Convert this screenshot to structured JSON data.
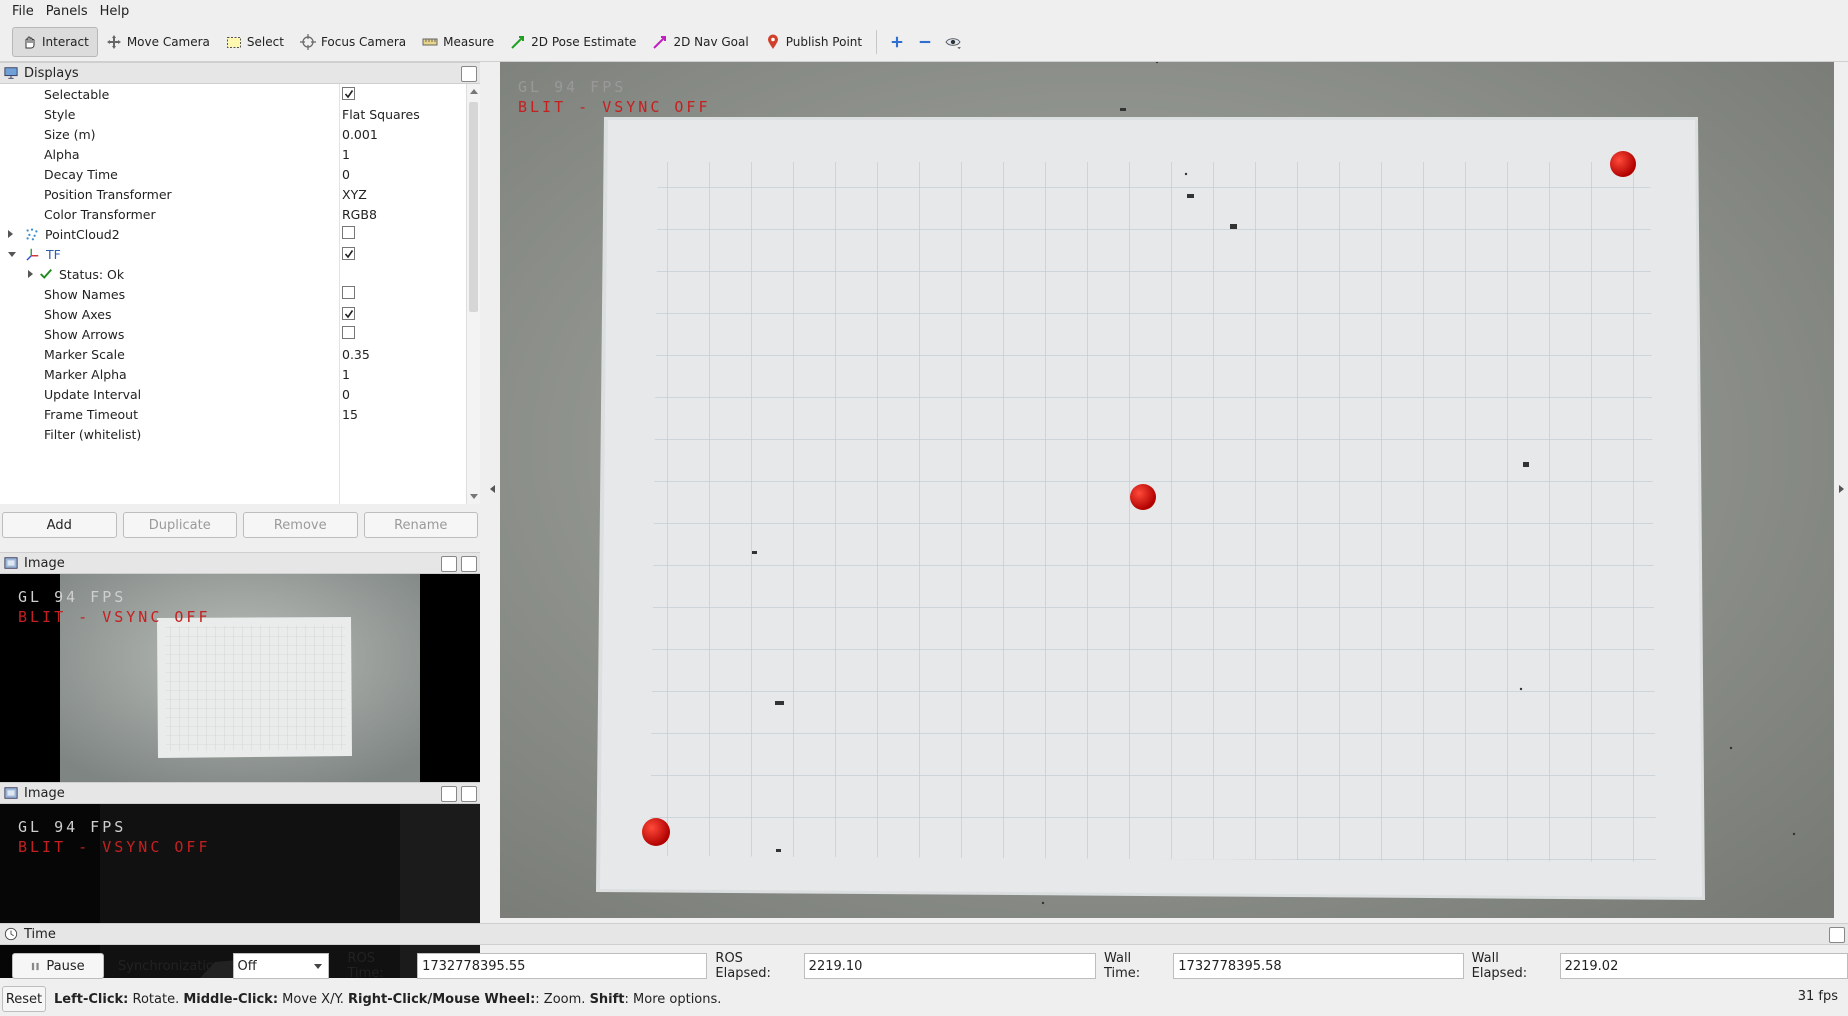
{
  "menu": [
    "File",
    "Panels",
    "Help"
  ],
  "toolbar": {
    "interact": "Interact",
    "move_camera": "Move Camera",
    "select": "Select",
    "focus_camera": "Focus Camera",
    "measure": "Measure",
    "pose_estimate": "2D Pose Estimate",
    "nav_goal": "2D Nav Goal",
    "publish_point": "Publish Point"
  },
  "displays": {
    "title": "Displays",
    "rows": [
      {
        "name": "Selectable",
        "value": "",
        "checkbox": true,
        "checked": true
      },
      {
        "name": "Style",
        "value": "Flat Squares"
      },
      {
        "name": "Size (m)",
        "value": "0.001"
      },
      {
        "name": "Alpha",
        "value": "1"
      },
      {
        "name": "Decay Time",
        "value": "0"
      },
      {
        "name": "Position Transformer",
        "value": "XYZ"
      },
      {
        "name": "Color Transformer",
        "value": "RGB8"
      },
      {
        "name": "PointCloud2",
        "value": "",
        "checkbox": true,
        "checked": false
      },
      {
        "name": "TF",
        "value": "",
        "checkbox": true,
        "checked": true
      },
      {
        "name": "Status: Ok",
        "value": ""
      },
      {
        "name": "Show Names",
        "value": "",
        "checkbox": true,
        "checked": false
      },
      {
        "name": "Show Axes",
        "value": "",
        "checkbox": true,
        "checked": true
      },
      {
        "name": "Show Arrows",
        "value": "",
        "checkbox": true,
        "checked": false
      },
      {
        "name": "Marker Scale",
        "value": "0.35"
      },
      {
        "name": "Marker Alpha",
        "value": "1"
      },
      {
        "name": "Update Interval",
        "value": "0"
      },
      {
        "name": "Frame Timeout",
        "value": "15"
      },
      {
        "name": "Filter (whitelist)",
        "value": ""
      }
    ],
    "buttons": {
      "add": "Add",
      "duplicate": "Duplicate",
      "remove": "Remove",
      "rename": "Rename"
    }
  },
  "image_panels": [
    {
      "title": "Image",
      "gl_fps": "GL 94 FPS",
      "blit": "BLIT - VSYNC OFF"
    },
    {
      "title": "Image",
      "gl_fps": "GL 94 FPS",
      "blit": "BLIT - VSYNC OFF"
    }
  ],
  "view3d": {
    "gl_fps": "GL 94 FPS",
    "blit": "BLIT - VSYNC OFF",
    "marker_color": "#e01010"
  },
  "time": {
    "title": "Time",
    "pause_label": "Pause",
    "sync_label": "Synchronization:",
    "sync_value": "Off",
    "ros_time_label": "ROS Time:",
    "ros_time": "1732778395.55",
    "ros_elapsed_label": "ROS Elapsed:",
    "ros_elapsed": "2219.10",
    "wall_time_label": "Wall Time:",
    "wall_time": "1732778395.58",
    "wall_elapsed_label": "Wall Elapsed:",
    "wall_elapsed": "2219.02"
  },
  "status": {
    "reset": "Reset",
    "left_click": "Left-Click:",
    "left_click_desc": " Rotate. ",
    "middle_click": "Middle-Click:",
    "middle_click_desc": " Move X/Y. ",
    "right_click": "Right-Click/Mouse Wheel:",
    "right_click_desc": ": Zoom. ",
    "shift": "Shift",
    "shift_desc": ": More options.",
    "fps": "31 fps"
  }
}
